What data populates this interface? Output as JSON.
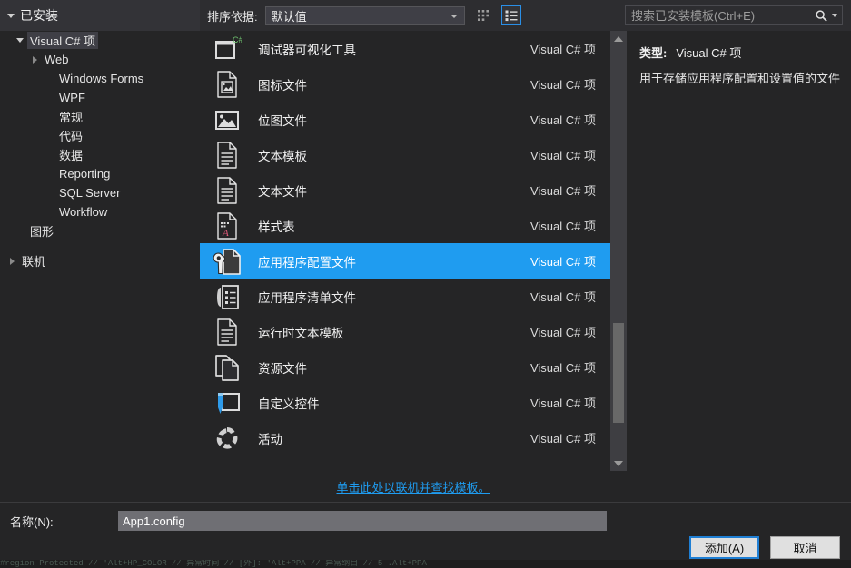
{
  "dialog": {
    "installed_header": "已安装",
    "sort_label": "排序依据:",
    "sort_value": "默认值",
    "search_placeholder": "搜索已安装模板(Ctrl+E)",
    "online_link": "单击此处以联机并查找模板。",
    "name_label": "名称(N):",
    "name_value": "App1.config",
    "add_button": "添加(A)",
    "cancel_button": "取消",
    "accent_color": "#1f9cf0",
    "background_color": "#252526",
    "bg_strip_text": "#region Protected   //  'Alt+HP_COLOR   // 异常时间  //  [外]: 'Alt+PPA  //  异常纲目  //  5 .Alt+PPA"
  },
  "tree": {
    "items": [
      {
        "label": "Visual C# 项",
        "level": 1,
        "expander": "down",
        "selected": true
      },
      {
        "label": "Web",
        "level": 2,
        "expander": "right",
        "selected": false
      },
      {
        "label": "Windows Forms",
        "level": 2,
        "expander": "none",
        "selected": false
      },
      {
        "label": "WPF",
        "level": 2,
        "expander": "none",
        "selected": false
      },
      {
        "label": "常规",
        "level": 2,
        "expander": "none",
        "selected": false
      },
      {
        "label": "代码",
        "level": 2,
        "expander": "none",
        "selected": false
      },
      {
        "label": "数据",
        "level": 2,
        "expander": "none",
        "selected": false
      },
      {
        "label": "Reporting",
        "level": 2,
        "expander": "none",
        "selected": false
      },
      {
        "label": "SQL Server",
        "level": 2,
        "expander": "none",
        "selected": false
      },
      {
        "label": "Workflow",
        "level": 2,
        "expander": "none",
        "selected": false
      },
      {
        "label": "图形",
        "level": 1,
        "expander": "none",
        "selected": false
      },
      {
        "label": "",
        "level": 1,
        "expander": "none",
        "selected": false,
        "spacer": true
      },
      {
        "label": "联机",
        "level": 0,
        "expander": "right",
        "selected": false
      }
    ]
  },
  "toolbar": {
    "grid_view_label": "grid-view",
    "list_view_label": "list-view",
    "list_view_active": true
  },
  "templates": [
    {
      "name": "调试器可视化工具",
      "kind": "Visual C# 项",
      "icon": "debugger-visualizer-icon",
      "selected": false
    },
    {
      "name": "图标文件",
      "kind": "Visual C# 项",
      "icon": "icon-file-icon",
      "selected": false
    },
    {
      "name": "位图文件",
      "kind": "Visual C# 项",
      "icon": "bitmap-file-icon",
      "selected": false
    },
    {
      "name": "文本模板",
      "kind": "Visual C# 项",
      "icon": "text-template-icon",
      "selected": false
    },
    {
      "name": "文本文件",
      "kind": "Visual C# 项",
      "icon": "text-file-icon",
      "selected": false
    },
    {
      "name": "样式表",
      "kind": "Visual C# 项",
      "icon": "stylesheet-icon",
      "selected": false
    },
    {
      "name": "应用程序配置文件",
      "kind": "Visual C# 项",
      "icon": "app-config-icon",
      "selected": true
    },
    {
      "name": "应用程序清单文件",
      "kind": "Visual C# 项",
      "icon": "app-manifest-icon",
      "selected": false
    },
    {
      "name": "运行时文本模板",
      "kind": "Visual C# 项",
      "icon": "runtime-text-template-icon",
      "selected": false
    },
    {
      "name": "资源文件",
      "kind": "Visual C# 项",
      "icon": "resource-file-icon",
      "selected": false
    },
    {
      "name": "自定义控件",
      "kind": "Visual C# 项",
      "icon": "custom-control-icon",
      "selected": false
    },
    {
      "name": "活动",
      "kind": "Visual C# 项",
      "icon": "activity-icon",
      "selected": false
    }
  ],
  "details": {
    "type_label": "类型:",
    "type_value": "Visual C# 项",
    "description": "用于存储应用程序配置和设置值的文件"
  }
}
